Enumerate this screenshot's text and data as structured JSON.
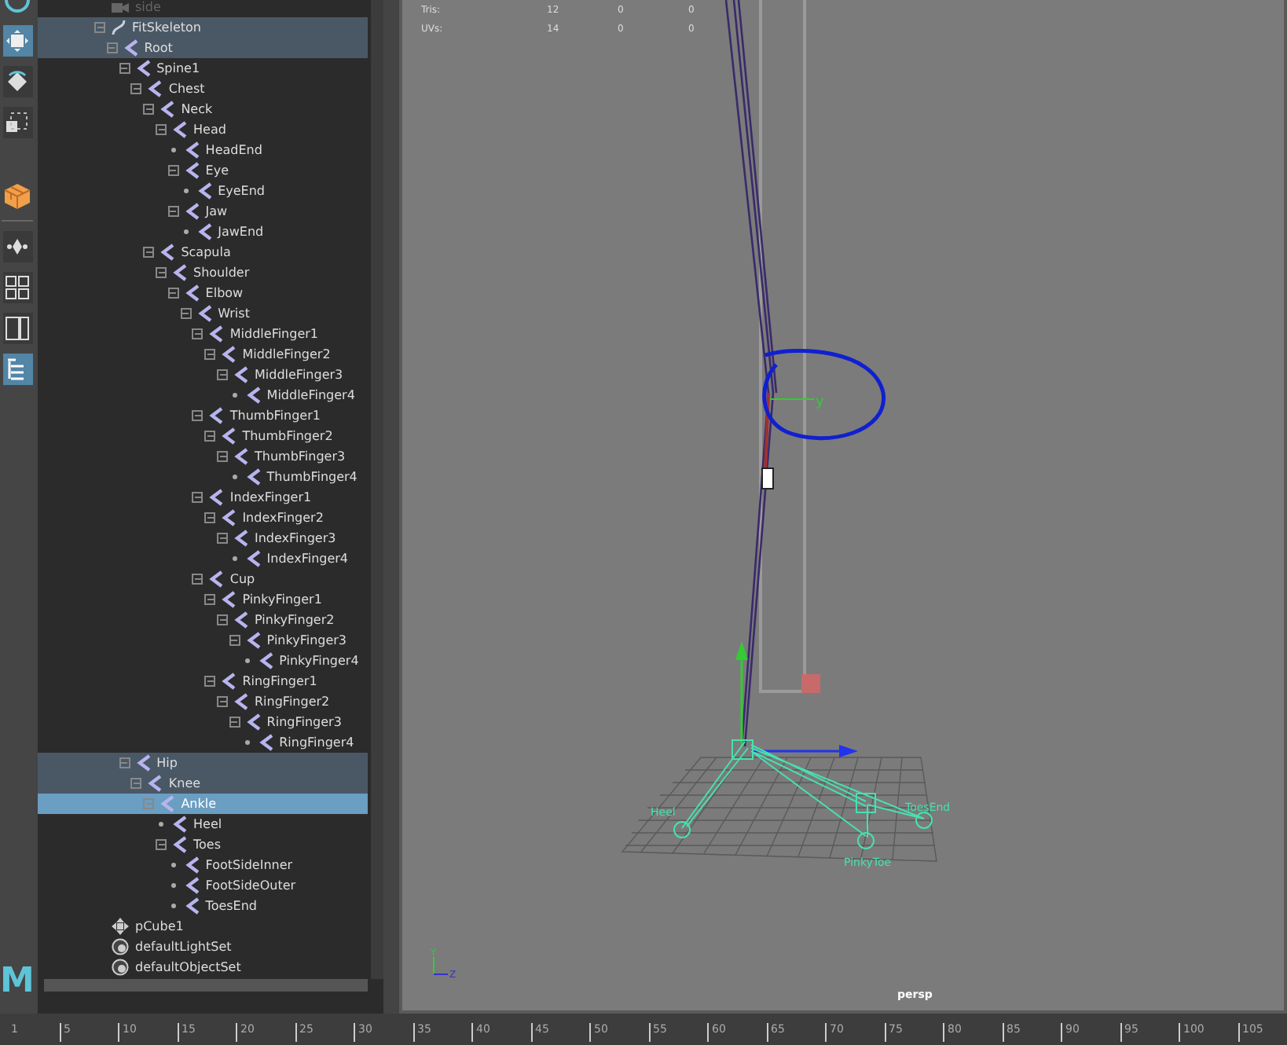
{
  "toolbar": {
    "logo": "M"
  },
  "outliner": {
    "items": [
      {
        "name": "side",
        "kind": "camera",
        "selected": false,
        "highlighted": false
      },
      {
        "name": "FitSkeleton",
        "kind": "curve",
        "selected": false,
        "highlighted": true,
        "children": [
          {
            "name": "Root",
            "kind": "joint",
            "selected": false,
            "highlighted": true,
            "children": [
              {
                "name": "Spine1",
                "kind": "joint",
                "selected": false,
                "highlighted": false,
                "children": [
                  {
                    "name": "Chest",
                    "kind": "joint",
                    "selected": false,
                    "highlighted": false,
                    "children": [
                      {
                        "name": "Neck",
                        "kind": "joint",
                        "selected": false,
                        "highlighted": false,
                        "children": [
                          {
                            "name": "Head",
                            "kind": "joint",
                            "selected": false,
                            "highlighted": false,
                            "children": [
                              {
                                "name": "HeadEnd",
                                "kind": "joint",
                                "selected": false,
                                "highlighted": false
                              },
                              {
                                "name": "Eye",
                                "kind": "joint",
                                "selected": false,
                                "highlighted": false,
                                "children": [
                                  {
                                    "name": "EyeEnd",
                                    "kind": "joint",
                                    "selected": false,
                                    "highlighted": false
                                  }
                                ]
                              },
                              {
                                "name": "Jaw",
                                "kind": "joint",
                                "selected": false,
                                "highlighted": false,
                                "children": [
                                  {
                                    "name": "JawEnd",
                                    "kind": "joint",
                                    "selected": false,
                                    "highlighted": false
                                  }
                                ]
                              }
                            ]
                          }
                        ]
                      },
                      {
                        "name": "Scapula",
                        "kind": "joint",
                        "selected": false,
                        "highlighted": false,
                        "children": [
                          {
                            "name": "Shoulder",
                            "kind": "joint",
                            "selected": false,
                            "highlighted": false,
                            "children": [
                              {
                                "name": "Elbow",
                                "kind": "joint",
                                "selected": false,
                                "highlighted": false,
                                "children": [
                                  {
                                    "name": "Wrist",
                                    "kind": "joint",
                                    "selected": false,
                                    "highlighted": false,
                                    "children": [
                                      {
                                        "name": "MiddleFinger1",
                                        "kind": "joint",
                                        "selected": false,
                                        "highlighted": false,
                                        "children": [
                                          {
                                            "name": "MiddleFinger2",
                                            "kind": "joint",
                                            "selected": false,
                                            "highlighted": false,
                                            "children": [
                                              {
                                                "name": "MiddleFinger3",
                                                "kind": "joint",
                                                "selected": false,
                                                "highlighted": false,
                                                "children": [
                                                  {
                                                    "name": "MiddleFinger4",
                                                    "kind": "joint",
                                                    "selected": false,
                                                    "highlighted": false
                                                  }
                                                ]
                                              }
                                            ]
                                          }
                                        ]
                                      },
                                      {
                                        "name": "ThumbFinger1",
                                        "kind": "joint",
                                        "selected": false,
                                        "highlighted": false,
                                        "children": [
                                          {
                                            "name": "ThumbFinger2",
                                            "kind": "joint",
                                            "selected": false,
                                            "highlighted": false,
                                            "children": [
                                              {
                                                "name": "ThumbFinger3",
                                                "kind": "joint",
                                                "selected": false,
                                                "highlighted": false,
                                                "children": [
                                                  {
                                                    "name": "ThumbFinger4",
                                                    "kind": "joint",
                                                    "selected": false,
                                                    "highlighted": false
                                                  }
                                                ]
                                              }
                                            ]
                                          }
                                        ]
                                      },
                                      {
                                        "name": "IndexFinger1",
                                        "kind": "joint",
                                        "selected": false,
                                        "highlighted": false,
                                        "children": [
                                          {
                                            "name": "IndexFinger2",
                                            "kind": "joint",
                                            "selected": false,
                                            "highlighted": false,
                                            "children": [
                                              {
                                                "name": "IndexFinger3",
                                                "kind": "joint",
                                                "selected": false,
                                                "highlighted": false,
                                                "children": [
                                                  {
                                                    "name": "IndexFinger4",
                                                    "kind": "joint",
                                                    "selected": false,
                                                    "highlighted": false
                                                  }
                                                ]
                                              }
                                            ]
                                          }
                                        ]
                                      },
                                      {
                                        "name": "Cup",
                                        "kind": "joint",
                                        "selected": false,
                                        "highlighted": false,
                                        "children": [
                                          {
                                            "name": "PinkyFinger1",
                                            "kind": "joint",
                                            "selected": false,
                                            "highlighted": false,
                                            "children": [
                                              {
                                                "name": "PinkyFinger2",
                                                "kind": "joint",
                                                "selected": false,
                                                "highlighted": false,
                                                "children": [
                                                  {
                                                    "name": "PinkyFinger3",
                                                    "kind": "joint",
                                                    "selected": false,
                                                    "highlighted": false,
                                                    "children": [
                                                      {
                                                        "name": "PinkyFinger4",
                                                        "kind": "joint",
                                                        "selected": false,
                                                        "highlighted": false
                                                      }
                                                    ]
                                                  }
                                                ]
                                              }
                                            ]
                                          },
                                          {
                                            "name": "RingFinger1",
                                            "kind": "joint",
                                            "selected": false,
                                            "highlighted": false,
                                            "children": [
                                              {
                                                "name": "RingFinger2",
                                                "kind": "joint",
                                                "selected": false,
                                                "highlighted": false,
                                                "children": [
                                                  {
                                                    "name": "RingFinger3",
                                                    "kind": "joint",
                                                    "selected": false,
                                                    "highlighted": false,
                                                    "children": [
                                                      {
                                                        "name": "RingFinger4",
                                                        "kind": "joint",
                                                        "selected": false,
                                                        "highlighted": false
                                                      }
                                                    ]
                                                  }
                                                ]
                                              }
                                            ]
                                          }
                                        ]
                                      }
                                    ]
                                  }
                                ]
                              }
                            ]
                          }
                        ]
                      }
                    ]
                  }
                ]
              },
              {
                "name": "Hip",
                "kind": "joint",
                "selected": false,
                "highlighted": true,
                "children": [
                  {
                    "name": "Knee",
                    "kind": "joint",
                    "selected": false,
                    "highlighted": true,
                    "children": [
                      {
                        "name": "Ankle",
                        "kind": "joint",
                        "selected": true,
                        "highlighted": false,
                        "children": [
                          {
                            "name": "Heel",
                            "kind": "joint",
                            "selected": false,
                            "highlighted": false
                          },
                          {
                            "name": "Toes",
                            "kind": "joint",
                            "selected": false,
                            "highlighted": false,
                            "children": [
                              {
                                "name": "FootSideInner",
                                "kind": "joint",
                                "selected": false,
                                "highlighted": false
                              },
                              {
                                "name": "FootSideOuter",
                                "kind": "joint",
                                "selected": false,
                                "highlighted": false
                              },
                              {
                                "name": "ToesEnd",
                                "kind": "joint",
                                "selected": false,
                                "highlighted": false
                              }
                            ]
                          }
                        ]
                      }
                    ]
                  }
                ]
              }
            ]
          }
        ]
      },
      {
        "name": "pCube1",
        "kind": "mesh",
        "selected": false,
        "highlighted": false
      },
      {
        "name": "defaultLightSet",
        "kind": "set",
        "selected": false,
        "highlighted": false
      },
      {
        "name": "defaultObjectSet",
        "kind": "set",
        "selected": false,
        "highlighted": false
      }
    ]
  },
  "viewport": {
    "stats": [
      {
        "label": "Tris:",
        "values": [
          "12",
          "0",
          "0"
        ]
      },
      {
        "label": "UVs:",
        "values": [
          "14",
          "0",
          "0"
        ]
      }
    ],
    "axis_label": "y",
    "joint_labels": [
      "Heel",
      "PinkyToe",
      "ToesEnd"
    ],
    "gizmo": [
      "Y",
      "Z"
    ],
    "camera": "persp"
  },
  "timeline": {
    "ticks": [
      "1",
      "5",
      "10",
      "15",
      "20",
      "25",
      "30",
      "35",
      "40",
      "45",
      "50",
      "55",
      "60",
      "65",
      "70",
      "75",
      "80",
      "85",
      "90",
      "95",
      "100",
      "105"
    ]
  }
}
